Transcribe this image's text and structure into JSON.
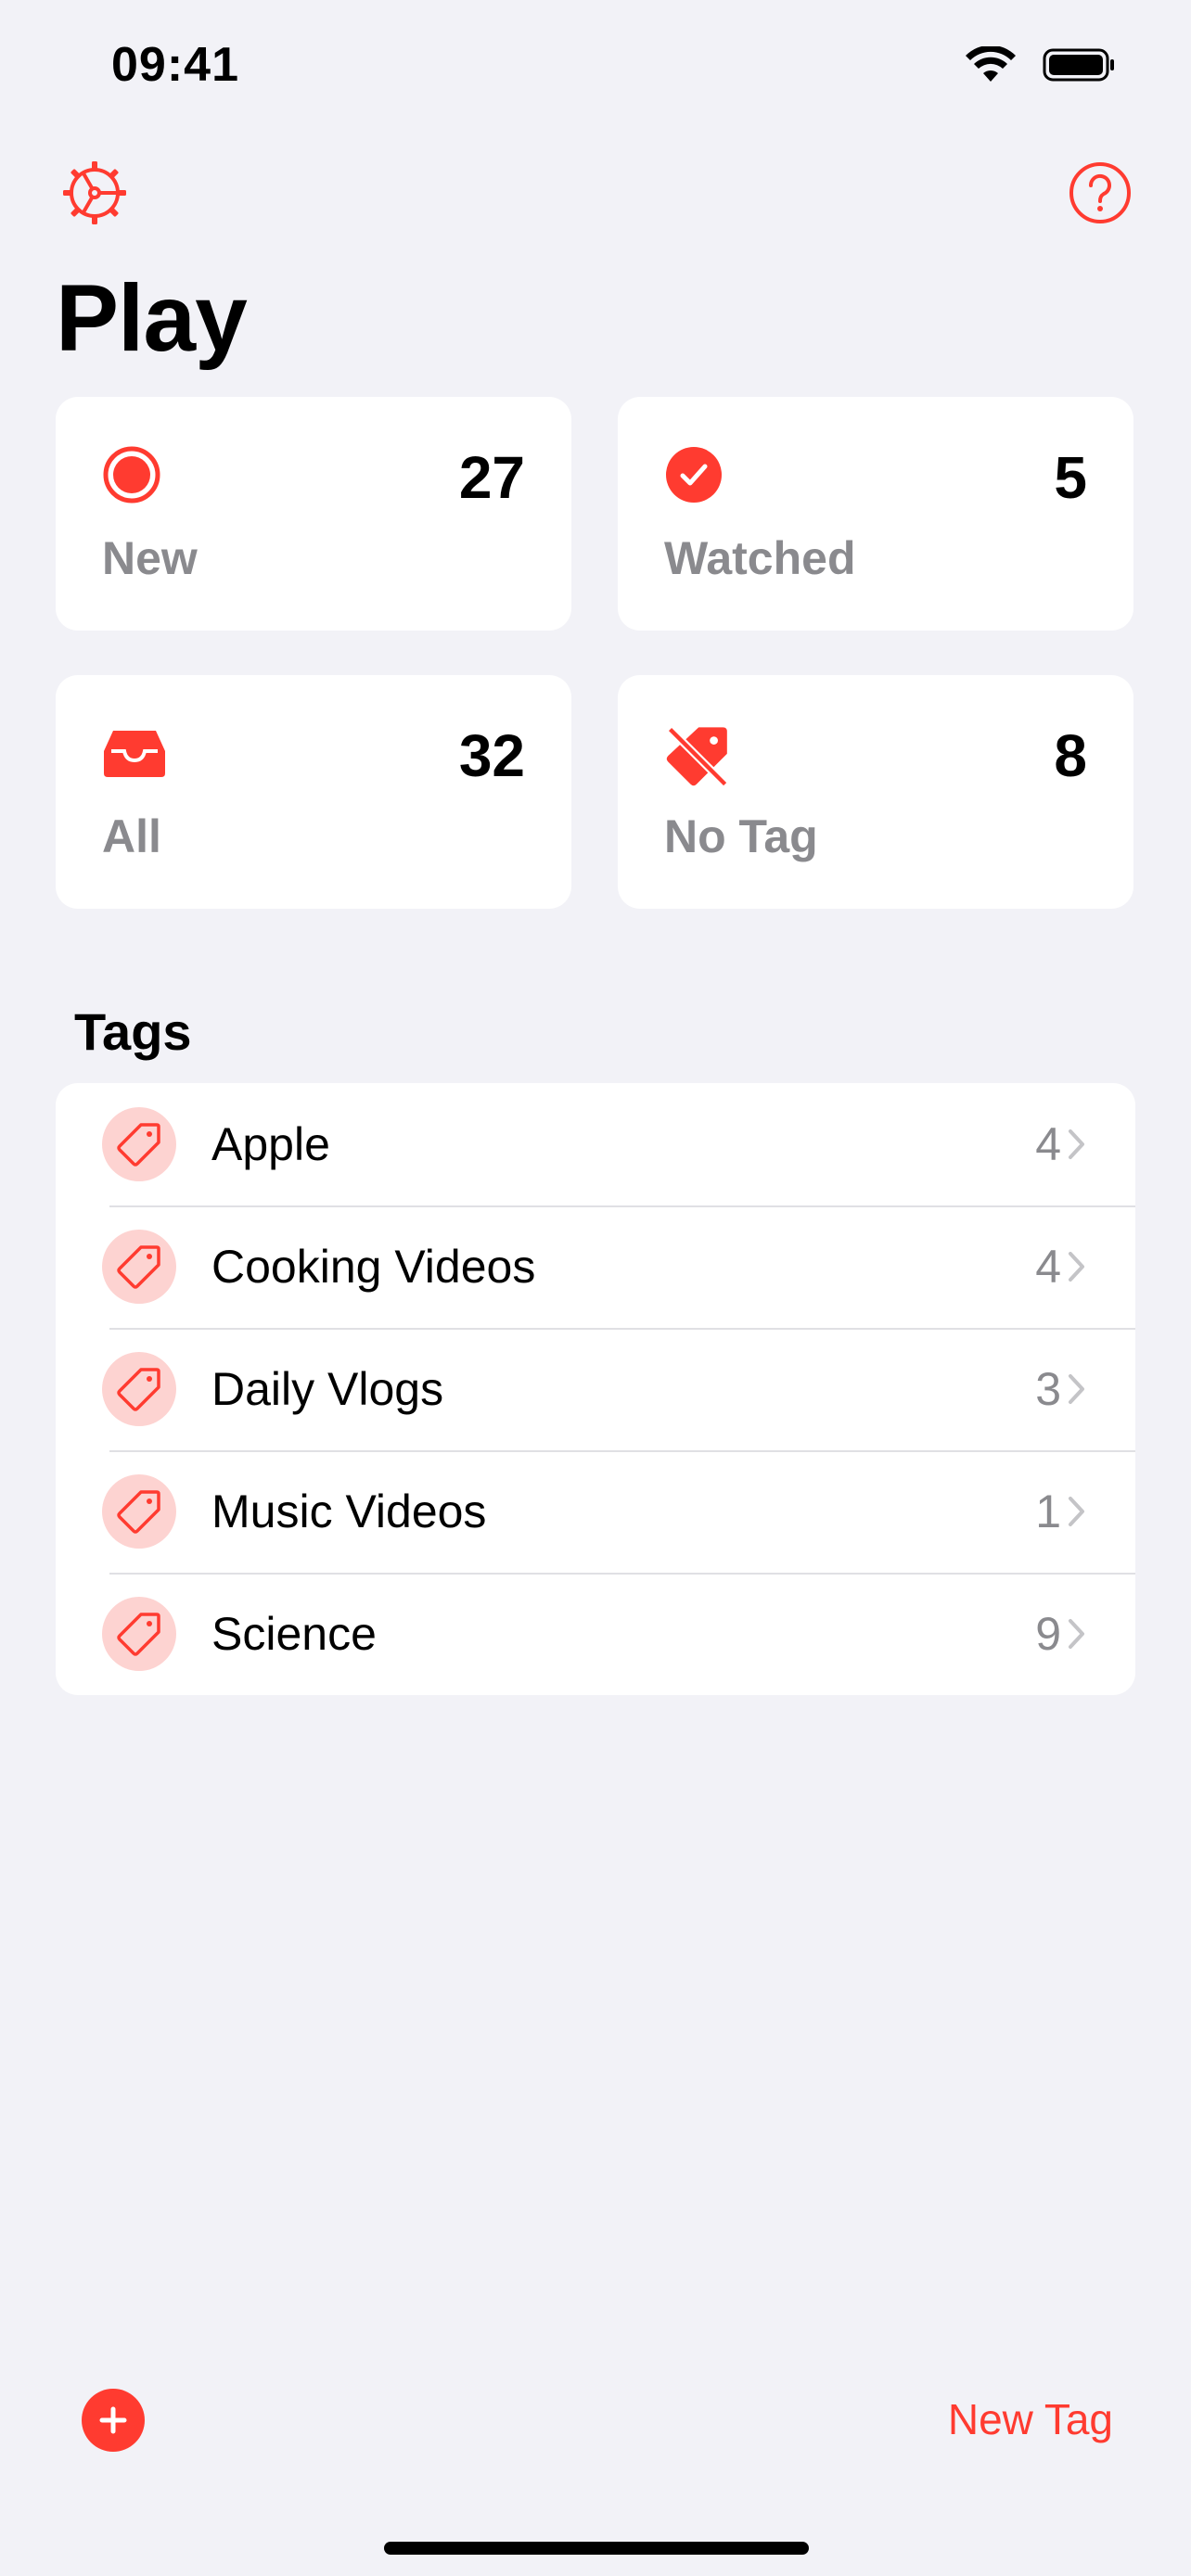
{
  "status_bar": {
    "time": "09:41",
    "icons": [
      "wifi-icon",
      "battery-icon"
    ]
  },
  "toolbar": {
    "settings_icon": "gear-icon",
    "help_icon": "question-circle-icon"
  },
  "title": "Play",
  "cards": [
    {
      "id": "new",
      "label": "New",
      "count": "27",
      "icon": "record-circle-icon"
    },
    {
      "id": "watched",
      "label": "Watched",
      "count": "5",
      "icon": "checkmark-circle-icon"
    },
    {
      "id": "all",
      "label": "All",
      "count": "32",
      "icon": "tray-icon"
    },
    {
      "id": "no_tag",
      "label": "No Tag",
      "count": "8",
      "icon": "tag-slash-icon"
    }
  ],
  "tags_section": {
    "header": "Tags",
    "items": [
      {
        "name": "Apple",
        "count": "4"
      },
      {
        "name": "Cooking Videos",
        "count": "4"
      },
      {
        "name": "Daily Vlogs",
        "count": "3"
      },
      {
        "name": "Music Videos",
        "count": "1"
      },
      {
        "name": "Science",
        "count": "9"
      }
    ]
  },
  "bottom_bar": {
    "add_icon": "plus-circle-icon",
    "new_tag_label": "New Tag"
  },
  "colors": {
    "accent": "#ff3b30",
    "background": "#f2f2f7",
    "secondary_text": "#8a8a8e",
    "tag_icon_bg": "#fdd3d1"
  }
}
